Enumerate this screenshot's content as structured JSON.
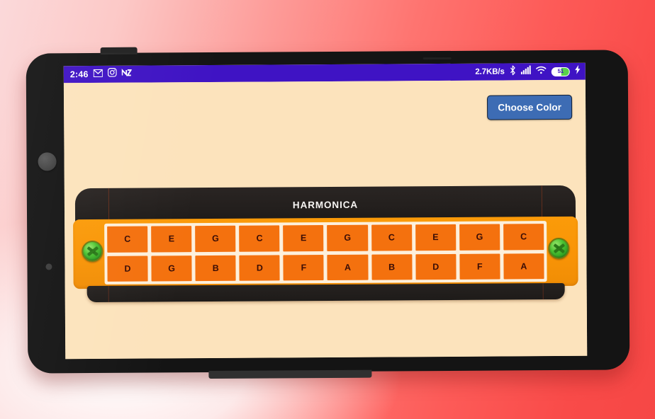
{
  "status_bar": {
    "time": "2:46",
    "network_speed": "2.7KB/s",
    "battery_level": "51",
    "icons": [
      "gmail-icon",
      "instagram-icon",
      "nova-launcher-icon",
      "bluetooth-icon",
      "signal-icon",
      "wifi-icon",
      "battery-icon",
      "charging-bolt-icon"
    ],
    "background_color": "#3f13c4"
  },
  "app": {
    "background_color": "#fce3bc",
    "choose_color_label": "Choose Color",
    "choose_color_bg": "#3d6cb4",
    "harmonica": {
      "title": "HARMONICA",
      "body_color": "#fb9b09",
      "cell_color": "#f4710e",
      "cover_plate_color": "#231f1d",
      "screw_color": "#4bc232",
      "blow_row": [
        "C",
        "E",
        "G",
        "C",
        "E",
        "G",
        "C",
        "E",
        "G",
        "C"
      ],
      "draw_row": [
        "D",
        "G",
        "B",
        "D",
        "F",
        "A",
        "B",
        "D",
        "F",
        "A"
      ]
    }
  }
}
